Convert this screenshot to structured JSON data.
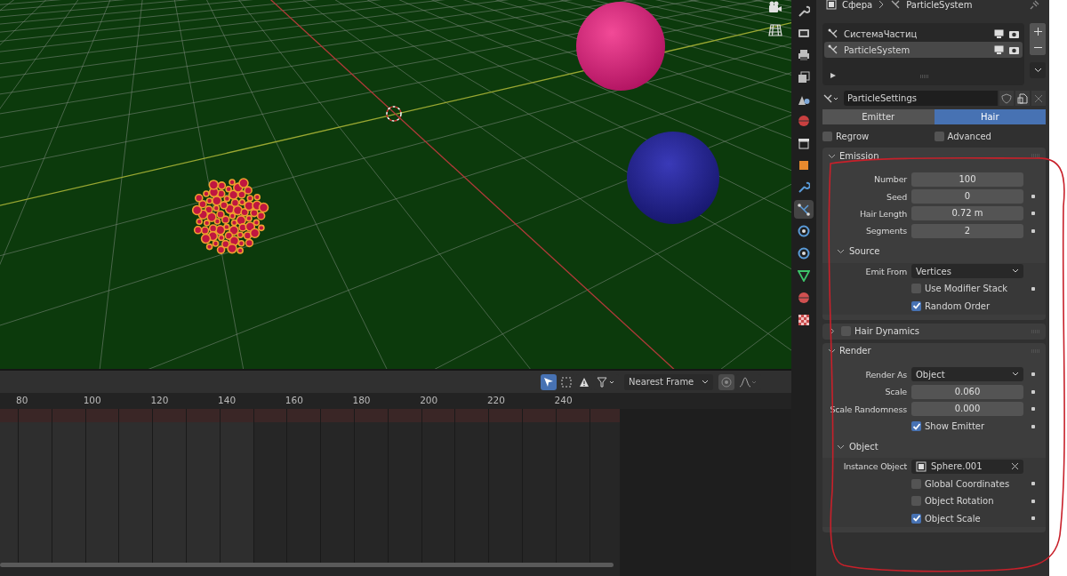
{
  "timeline": {
    "snapping": "Nearest Frame",
    "frame_labels": [
      "80",
      "100",
      "120",
      "140",
      "160",
      "180",
      "200",
      "220",
      "240"
    ]
  },
  "properties": {
    "breadcrumb": [
      "Сфера",
      "ParticleSystem"
    ],
    "tabs": [
      {
        "kind": "tool",
        "selected": false
      },
      {
        "kind": "render",
        "selected": false
      },
      {
        "kind": "output",
        "selected": false
      },
      {
        "kind": "view_layer",
        "selected": false
      },
      {
        "kind": "scene",
        "selected": false
      },
      {
        "kind": "world",
        "selected": false
      },
      {
        "kind": "collection",
        "selected": false
      },
      {
        "kind": "object",
        "selected": false
      },
      {
        "kind": "modifiers",
        "selected": false
      },
      {
        "kind": "particles",
        "selected": true
      },
      {
        "kind": "physics",
        "selected": false
      },
      {
        "kind": "constraints",
        "selected": false
      },
      {
        "kind": "data",
        "selected": false
      },
      {
        "kind": "material",
        "selected": false
      },
      {
        "kind": "texture",
        "selected": false
      }
    ],
    "systems": [
      {
        "name": "СистемаЧастиц",
        "selected": false
      },
      {
        "name": "ParticleSystem",
        "selected": true
      }
    ],
    "settings_name": "ParticleSettings",
    "type_tabs": [
      {
        "label": "Emitter",
        "selected": false
      },
      {
        "label": "Hair",
        "selected": true
      }
    ],
    "options": [
      {
        "label": "Regrow",
        "checked": false
      },
      {
        "label": "Advanced",
        "checked": false
      }
    ],
    "panels": [
      {
        "title": "Emission",
        "expanded": true,
        "rows": [
          {
            "kind": "number",
            "label": "Number",
            "value": "100"
          },
          {
            "kind": "number",
            "label": "Seed",
            "value": "0",
            "decorator": true
          },
          {
            "kind": "number",
            "label": "Hair Length",
            "value": "0.72 m",
            "decorator": true
          },
          {
            "kind": "number",
            "label": "Segments",
            "value": "2",
            "decorator": true
          },
          {
            "kind": "subpanel",
            "title": "Source",
            "expanded": true,
            "rows": [
              {
                "kind": "dropdown",
                "label": "Emit From",
                "value": "Vertices"
              },
              {
                "kind": "check",
                "label": "Use Modifier Stack",
                "checked": false,
                "decorator": true
              },
              {
                "kind": "check",
                "label": "Random Order",
                "checked": true
              }
            ]
          }
        ]
      },
      {
        "title": "Hair Dynamics",
        "expanded": false,
        "enabled": false
      },
      {
        "title": "Render",
        "expanded": true,
        "rows": [
          {
            "kind": "dropdown",
            "label": "Render As",
            "value": "Object",
            "decorator": true
          },
          {
            "kind": "number",
            "label": "Scale",
            "value": "0.060",
            "decorator": true
          },
          {
            "kind": "number",
            "label": "Scale Randomness",
            "value": "0.000",
            "decorator": true
          },
          {
            "kind": "check",
            "label": "Show Emitter",
            "checked": true,
            "decorator": true
          },
          {
            "kind": "subpanel",
            "title": "Object",
            "expanded": true,
            "rows": [
              {
                "kind": "object",
                "label": "Instance Object",
                "value": "Sphere.001"
              },
              {
                "kind": "check",
                "label": "Global Coordinates",
                "checked": false,
                "decorator": true
              },
              {
                "kind": "check",
                "label": "Object Rotation",
                "checked": false,
                "decorator": true
              },
              {
                "kind": "check",
                "label": "Object Scale",
                "checked": true,
                "decorator": true
              }
            ]
          }
        ]
      }
    ]
  }
}
